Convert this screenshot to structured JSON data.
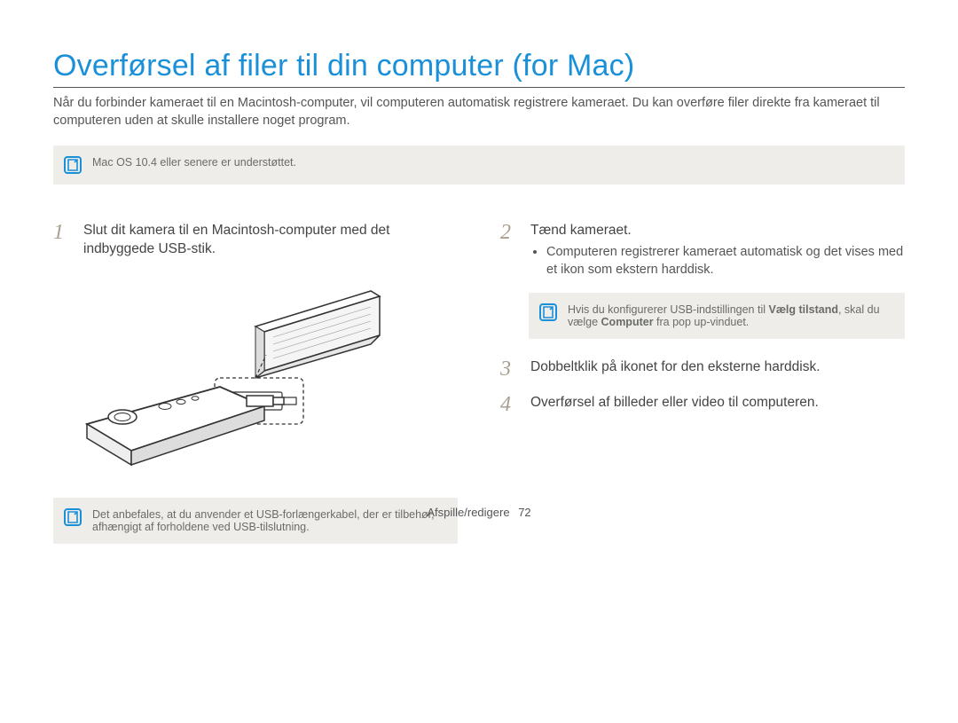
{
  "title": "Overførsel af filer til din computer (for Mac)",
  "intro": "Når du forbinder kameraet til en Macintosh-computer, vil computeren automatisk registrere kameraet. Du kan overføre filer direkte fra kameraet til computeren uden at skulle installere noget program.",
  "top_note": "Mac OS 10.4 eller senere er understøttet.",
  "left": {
    "step1_num": "1",
    "step1_text": "Slut dit kamera til en Macintosh-computer med det indbyggede USB-stik.",
    "bottom_note": "Det anbefales, at du anvender et USB-forlængerkabel, der er tilbehør, afhængigt af forholdene ved USB-tilslutning."
  },
  "right": {
    "step2_num": "2",
    "step2_text": "Tænd kameraet.",
    "step2_bullet": "Computeren registrerer kameraet automatisk og det vises med et ikon som ekstern harddisk.",
    "note_prefix": "Hvis du konfigurerer USB-indstillingen til ",
    "note_bold1": "Vælg tilstand",
    "note_mid": ", skal du vælge ",
    "note_bold2": "Computer",
    "note_suffix": " fra pop up-vinduet.",
    "step3_num": "3",
    "step3_text": "Dobbeltklik på ikonet for den eksterne harddisk.",
    "step4_num": "4",
    "step4_text": "Overførsel af billeder eller video til computeren."
  },
  "footer_label": "Afspille/redigere",
  "footer_page": "72"
}
